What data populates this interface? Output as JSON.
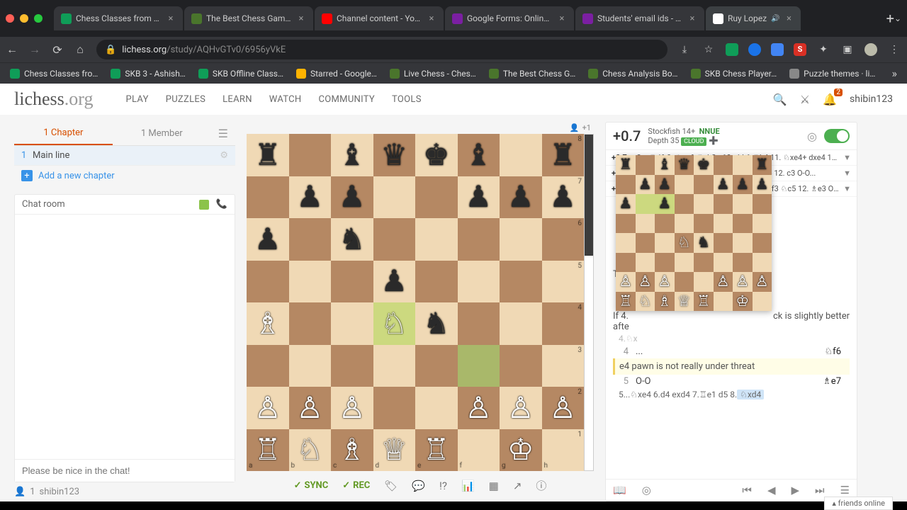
{
  "browser": {
    "tabs": [
      {
        "label": "Chess Classes from Jun",
        "fav": "#0f9d58"
      },
      {
        "label": "The Best Chess Games",
        "fav": "#4a752c"
      },
      {
        "label": "Channel content - YouTu",
        "fav": "#ff0000"
      },
      {
        "label": "Google Forms: Online Fo",
        "fav": "#7b1fa2"
      },
      {
        "label": "Students' email ids - Go",
        "fav": "#7b1fa2"
      },
      {
        "label": "Ruy Lopez",
        "fav": "#fff",
        "active": true,
        "audio": true
      }
    ],
    "url_host": "lichess.org",
    "url_path": "/study/AQHvGTv0/6956yVkE",
    "bookmarks": [
      {
        "label": "Chess Classes fro…",
        "color": "#0f9d58"
      },
      {
        "label": "SKB 3 - Ashish…",
        "color": "#0f9d58"
      },
      {
        "label": "SKB Offline Class…",
        "color": "#0f9d58"
      },
      {
        "label": "Starred - Google…",
        "color": "#ffb300"
      },
      {
        "label": "Live Chess - Ches…",
        "color": "#4a752c"
      },
      {
        "label": "The Best Chess G…",
        "color": "#4a752c"
      },
      {
        "label": "Chess Analysis Bo…",
        "color": "#4a752c"
      },
      {
        "label": "SKB Chess Player…",
        "color": "#4a752c"
      },
      {
        "label": "Puzzle themes · li…",
        "color": "#888"
      }
    ]
  },
  "lichess": {
    "logo_main": "lichess",
    "logo_sub": ".org",
    "nav": [
      "PLAY",
      "PUZZLES",
      "LEARN",
      "WATCH",
      "COMMUNITY",
      "TOOLS"
    ],
    "user": "shibin123",
    "notif_count": "2"
  },
  "left": {
    "tab_chapter": "1 Chapter",
    "tab_member": "1 Member",
    "chapter_num": "1",
    "chapter_name": "Main line",
    "add_chapter": "Add a new chapter",
    "chat_title": "Chat room",
    "chat_placeholder": "Please be nice in the chat!",
    "contributor_user": "shibin123"
  },
  "board": {
    "spectators": "+1",
    "position": {
      "a8": "♜",
      "c8": "♝",
      "d8": "♛",
      "e8": "♚",
      "f8": "♝",
      "h8": "♜",
      "b7": "♟",
      "c7": "♟",
      "f7": "♟",
      "g7": "♟",
      "h7": "♟",
      "a6": "♟",
      "c6": "♞",
      "d5": "♟",
      "a4": "♗",
      "d4": "♘",
      "e4": "♞",
      "a2": "♙",
      "b2": "♙",
      "c2": "♙",
      "f2": "♙",
      "g2": "♙",
      "h2": "♙",
      "a1": "♖",
      "b1": "♘",
      "c1": "♗",
      "d1": "♕",
      "e1": "♖",
      "g1": "♔"
    },
    "highlights": [
      "d4"
    ],
    "highlights2": [
      "f3"
    ],
    "actions": {
      "sync": "SYNC",
      "rec": "REC"
    }
  },
  "mini_position": {
    "a8": "♜",
    "c8": "♝",
    "d8": "♛",
    "e8": "♚",
    "h8": "♜",
    "b7": "♟",
    "c7": "♟",
    "f7": "♟",
    "g7": "♟",
    "h7": "♟",
    "a6": "♟",
    "c6": "♟",
    "d4": "♘",
    "e4": "♞",
    "a2": "♙",
    "b2": "♙",
    "c2": "♙",
    "f2": "♙",
    "g2": "♙",
    "h2": "♙",
    "a1": "♖",
    "b1": "♘",
    "c1": "♗",
    "d1": "♕",
    "e1": "♖",
    "g1": "♔"
  },
  "mini_highlights": [
    "b6",
    "c6"
  ],
  "eval": {
    "score": "+0.7",
    "engine": "Stockfish 14+",
    "nnue": "NNUE",
    "depth": "Depth 35",
    "cloud": "CLOUD",
    "pvs": [
      {
        "s": "+0.7",
        "line": "8...  ♕d6 9. ♘xc6 ♕xh2+ 10. ♔h1 ♕h4 11. ♘xe4+ dxe4 12..."
      },
      {
        "s": "+1.7",
        "line": "8...  ♘xc6+ bxc6 10. f3 ♕h4 11. g3 ♕h5 12. c3 O-O..."
      },
      {
        "s": "+2.7",
        "line": "8...  ♕h4 9. g3 ♕f6 10. ♘xc6+ bxc6 11. f3 ♘c5 12. ♗e3 O-..."
      }
    ]
  },
  "moves": {
    "comment1": "The",
    "comment_if": "If 4.",
    "comment_slight": "ck is slightly better",
    "comment_after": "afte",
    "row4a": "4.♘x",
    "row4n": "4",
    "row4w": "...",
    "row4b": "♘f6",
    "comment_e4": "e4 pawn is not really under threat",
    "row5n": "5",
    "row5w": "O-O",
    "row5b": "♗e7",
    "var_text": "5...♘xe4 6.d4 exd4 7.♖e1 d5 8.",
    "var_hl": "♘xd4"
  },
  "friends": "friends online"
}
